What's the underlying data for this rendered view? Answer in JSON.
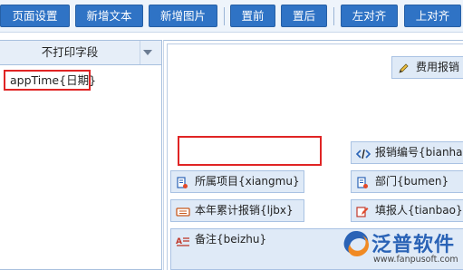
{
  "toolbar": {
    "buttons": [
      {
        "label": "页面设置"
      },
      {
        "label": "新增文本"
      },
      {
        "label": "新增图片"
      },
      {
        "label": "置前"
      },
      {
        "label": "置后"
      },
      {
        "label": "左对齐"
      },
      {
        "label": "上对齐"
      }
    ]
  },
  "left_panel": {
    "header": "不打印字段",
    "items": [
      {
        "label": "appTime{日期}"
      }
    ]
  },
  "canvas": {
    "fields": {
      "fee_report": {
        "label": "费用报销",
        "icon": "pencil-icon"
      },
      "report_no": {
        "label": "报销编号{bianhao",
        "icon": "code-icon"
      },
      "project": {
        "label": "所属项目{xiangmu}",
        "icon": "file-edit-icon"
      },
      "department": {
        "label": "部门{bumen}",
        "icon": "file-edit-icon"
      },
      "year_total": {
        "label": "本年累计报销{ljbx}",
        "icon": "keyboard-icon"
      },
      "reporter": {
        "label": "填报人{tianbao}",
        "icon": "edit-pen-icon"
      },
      "remark": {
        "label": "备注{beizhu}",
        "icon": "text-lines-icon"
      }
    }
  },
  "watermark": {
    "brand": "泛普软件",
    "url": "www.fanpusoft.com"
  },
  "colors": {
    "toolbar_button": "#2f73c5",
    "highlight_red": "#e02424",
    "field_bg": "#dfeaf7"
  }
}
